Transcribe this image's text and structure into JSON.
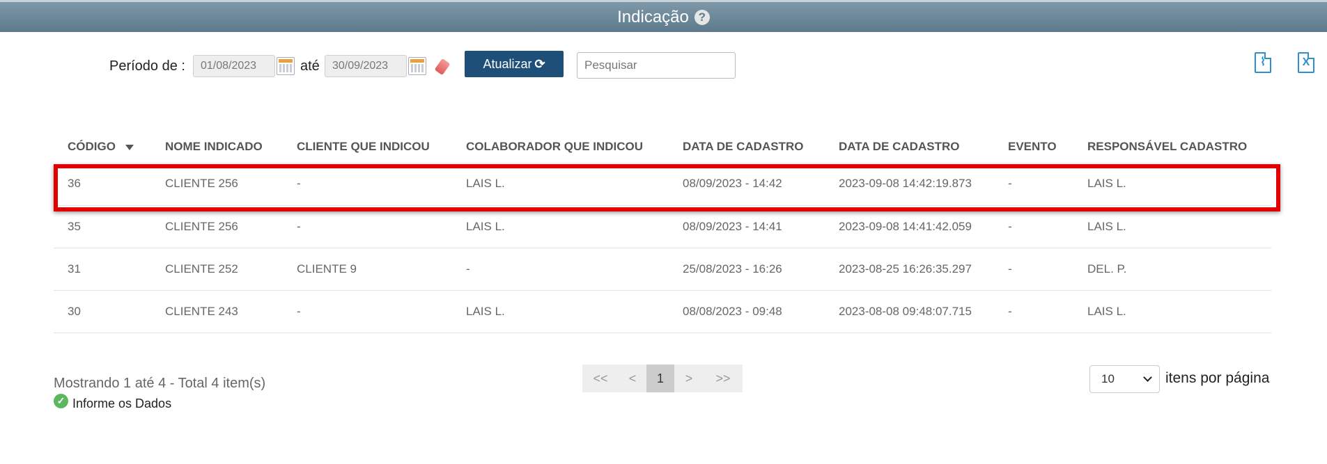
{
  "header": {
    "title": "Indicação",
    "help_icon": "question-circle-icon"
  },
  "filter": {
    "period_label": "Período de :",
    "date_from": "01/08/2023",
    "until_label": "até",
    "date_to": "30/09/2023",
    "update_button": "Atualizar",
    "search_placeholder": "Pesquisar"
  },
  "export": {
    "pdf_icon": "pdf-file-icon",
    "excel_icon": "excel-file-icon"
  },
  "table": {
    "columns": [
      "CÓDIGO",
      "NOME INDICADO",
      "CLIENTE QUE INDICOU",
      "COLABORADOR QUE INDICOU",
      "DATA DE CADASTRO",
      "DATA DE CADASTRO",
      "EVENTO",
      "RESPONSÁVEL CADASTRO"
    ],
    "rows": [
      [
        "36",
        "CLIENTE 256",
        "-",
        "LAIS L.",
        "08/09/2023 - 14:42",
        "2023-09-08 14:42:19.873",
        "-",
        "LAIS L."
      ],
      [
        "35",
        "CLIENTE 256",
        "-",
        "LAIS L.",
        "08/09/2023 - 14:41",
        "2023-09-08 14:41:42.059",
        "-",
        "LAIS L."
      ],
      [
        "31",
        "CLIENTE 252",
        "CLIENTE 9",
        "-",
        "25/08/2023 - 16:26",
        "2023-08-25 16:26:35.297",
        "-",
        "DEL. P."
      ],
      [
        "30",
        "CLIENTE 243",
        "-",
        "LAIS L.",
        "08/08/2023 - 09:48",
        "2023-08-08 09:48:07.715",
        "-",
        "LAIS L."
      ]
    ]
  },
  "footer": {
    "showing": "Mostrando 1 até 4 - Total 4 item(s)",
    "info": "Informe os Dados",
    "pager": {
      "first": "<<",
      "prev": "<",
      "current": "1",
      "next": ">",
      "last": ">>"
    },
    "per_page_value": "10",
    "per_page_label": "itens por página"
  },
  "colors": {
    "header_bg": "#5c7a8c",
    "button_bg": "#1e4f79",
    "highlight": "#e00000",
    "export_icon": "#2d8fd0",
    "ok_green": "#5cb85c"
  }
}
